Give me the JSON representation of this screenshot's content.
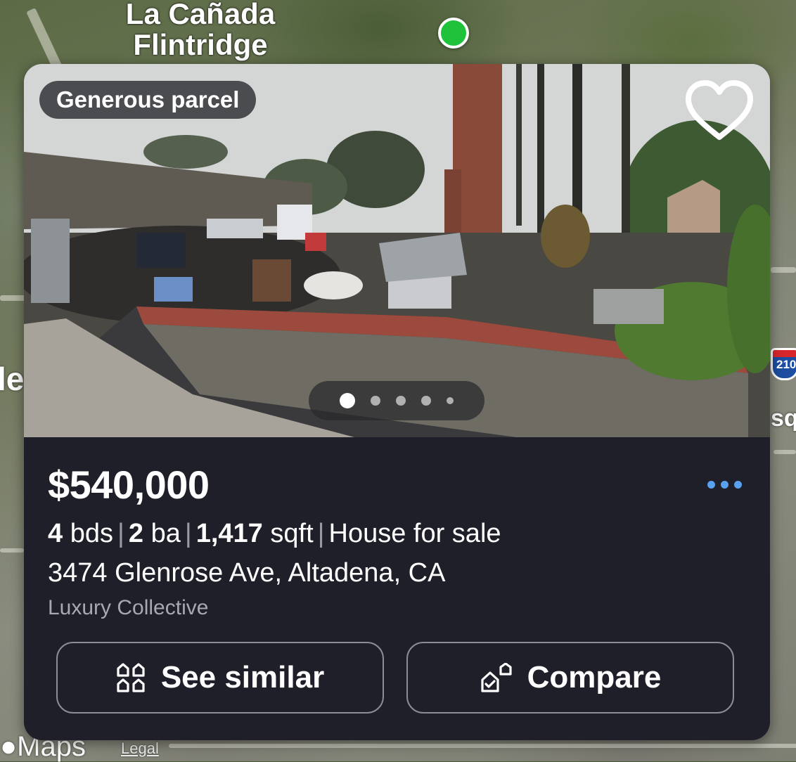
{
  "map": {
    "place_line1": "La Cañada",
    "place_line2": "Flintridge",
    "left_fragment": "le",
    "right_fragment": "sq",
    "highway_number": "210",
    "brand": "Maps",
    "legal": "Legal"
  },
  "listing": {
    "tag": "Generous parcel",
    "price": "$540,000",
    "beds_value": "4",
    "beds_unit": "bds",
    "baths_value": "2",
    "baths_unit": "ba",
    "sqft_value": "1,417",
    "sqft_unit": "sqft",
    "status": "House for sale",
    "separator": "|",
    "address": "3474 Glenrose Ave, Altadena, CA",
    "broker": "Luxury Collective",
    "photo_count": 5,
    "active_photo_index": 0
  },
  "actions": {
    "see_similar": "See similar",
    "compare": "Compare"
  },
  "icons": {
    "favorite": "heart-outline-icon",
    "more": "ellipsis-icon",
    "see_similar": "houses-grid-icon",
    "compare": "house-compare-icon",
    "brand": "apple-logo-icon"
  },
  "colors": {
    "card_background": "#1f1f2a",
    "accent_dots": "#5aa0f0",
    "location_dot": "#1fc23a"
  }
}
